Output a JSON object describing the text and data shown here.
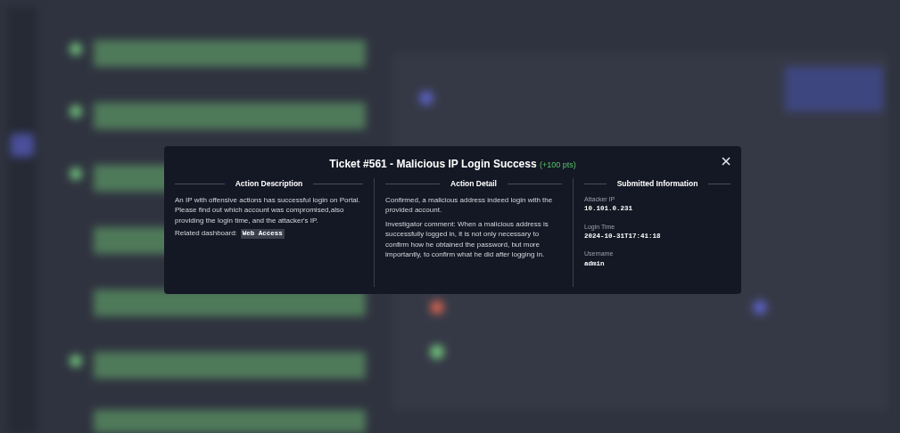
{
  "modal": {
    "title": "Ticket #561 - Malicious IP Login Success",
    "points": "(+100 pts)",
    "description": {
      "heading": "Action Description",
      "text": "An IP with offensive actions has successful login on Portal. Please find out which account was compromised,also providing the login time, and the attacker's IP.",
      "dashboard_label": "Related dashboard:",
      "dashboard_link": "Web Access"
    },
    "detail": {
      "heading": "Action Detail",
      "paragraphs": [
        "Confirmed, a malicious address indeed login with the provided account.",
        "Investigator comment: When a malicious address is successfully logged in, it is not only necessary to confirm how he obtained the password, but more importantly, to confirm what he did after logging in."
      ]
    },
    "submitted": {
      "heading": "Submitted Information",
      "fields": [
        {
          "label": "Attacker IP",
          "value": "10.101.0.231"
        },
        {
          "label": "Login Time",
          "value": "2024-10-31T17:41:18"
        },
        {
          "label": "Username",
          "value": "admin"
        }
      ]
    }
  }
}
